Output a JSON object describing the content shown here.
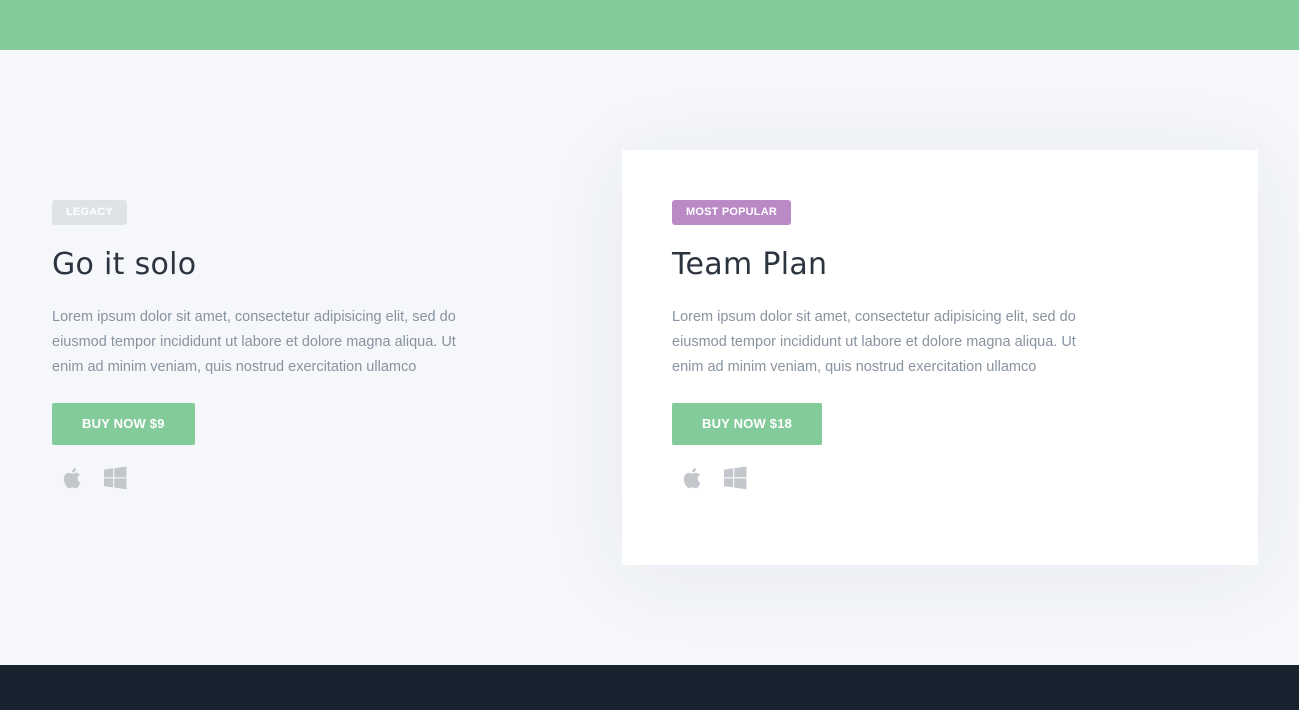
{
  "colors": {
    "accent_green": "#84cb9b",
    "badge_legacy": "#dfe2e6",
    "badge_popular": "#b98ac6",
    "footer": "#19222f",
    "background": "#f5f7fa"
  },
  "plans": [
    {
      "badge": "LEGACY",
      "title": "Go it solo",
      "description": "Lorem ipsum dolor sit amet, consectetur adipisicing elit, sed do eiusmod tempor incididunt ut labore et dolore magna aliqua. Ut enim ad minim veniam, quis nostrud exercitation ullamco",
      "button_label": "BUY NOW $9",
      "platform_icons": [
        "apple-icon",
        "windows-icon"
      ]
    },
    {
      "badge": "MOST POPULAR",
      "title": "Team Plan",
      "description": "Lorem ipsum dolor sit amet, consectetur adipisicing elit, sed do eiusmod tempor incididunt ut labore et dolore magna aliqua. Ut enim ad minim veniam, quis nostrud exercitation ullamco",
      "button_label": "BUY NOW $18",
      "platform_icons": [
        "apple-icon",
        "windows-icon"
      ]
    }
  ]
}
